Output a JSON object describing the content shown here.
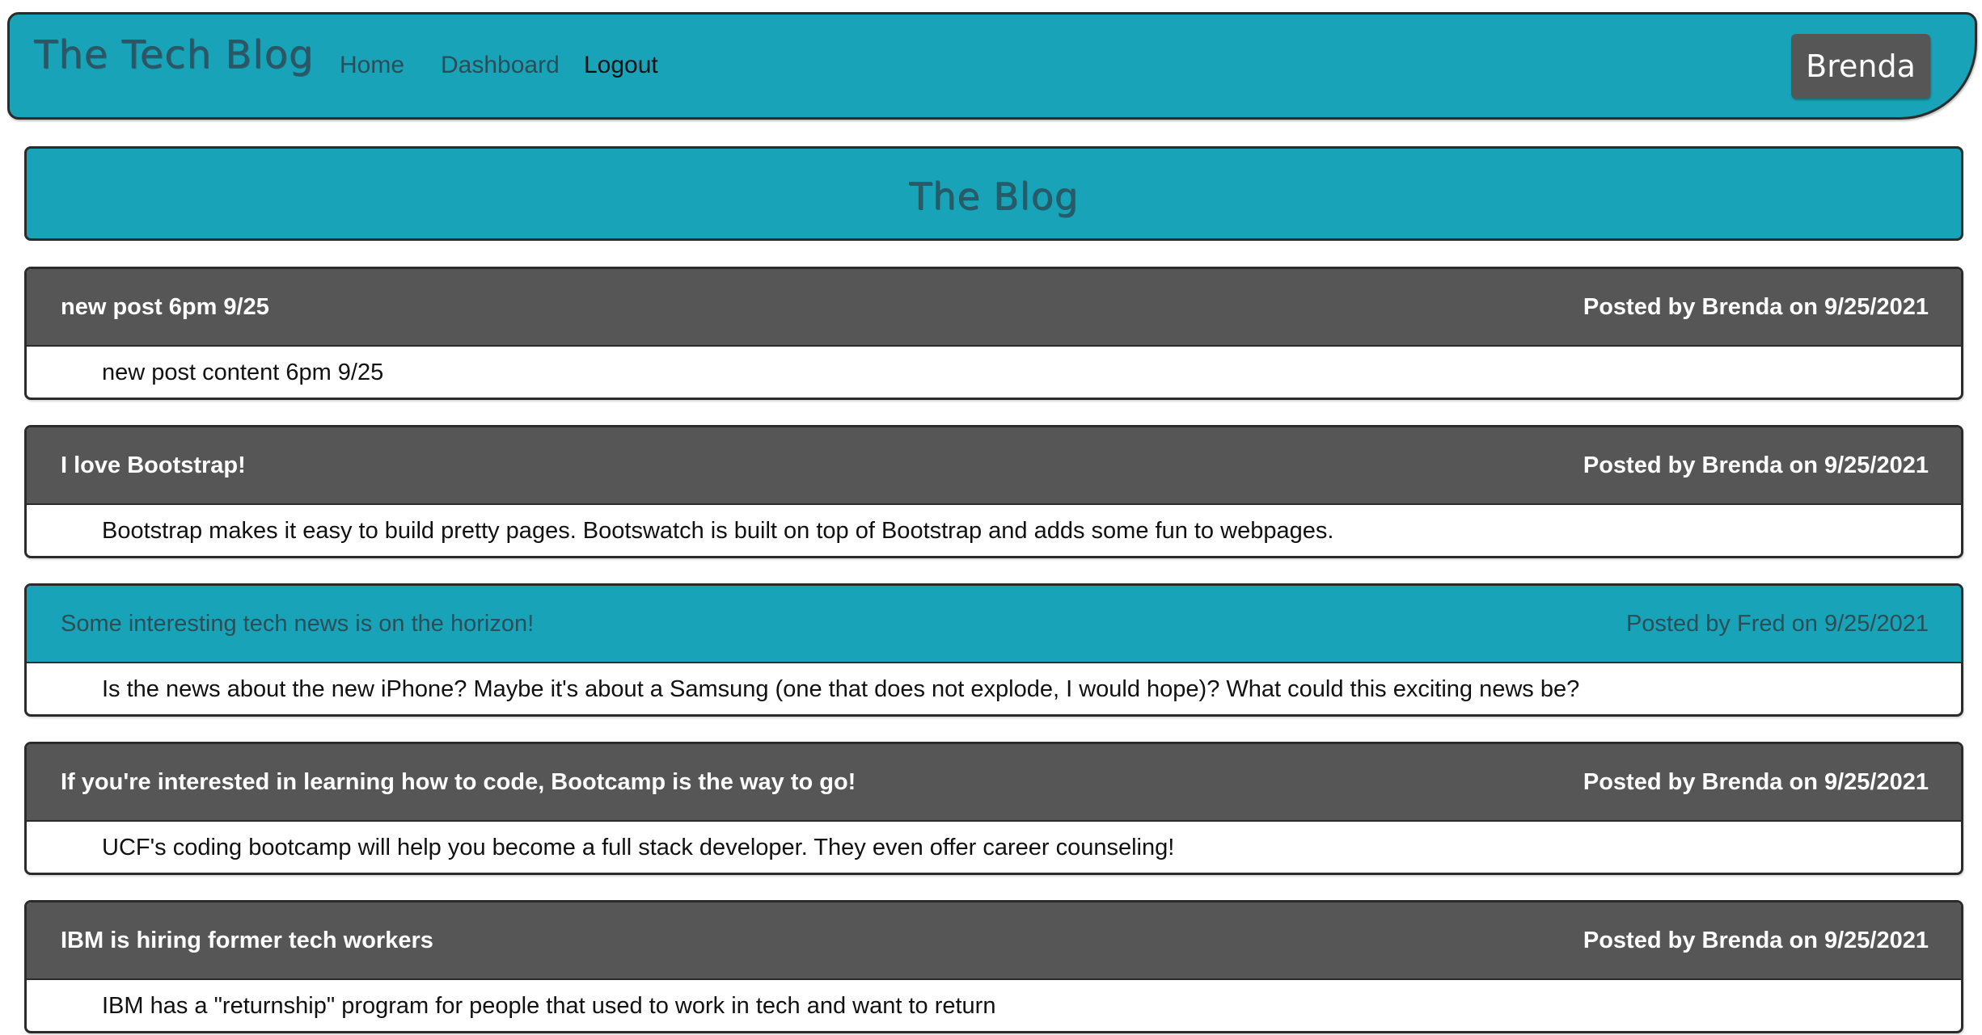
{
  "header": {
    "brand": "The Tech Blog",
    "nav": [
      "Home",
      "Dashboard",
      "Logout"
    ],
    "user": "Brenda"
  },
  "hero": {
    "title": "The Blog"
  },
  "posts": [
    {
      "title": "new post 6pm 9/25",
      "meta": "Posted by Brenda on 9/25/2021",
      "content": "new post content 6pm 9/25"
    },
    {
      "title": "I love Bootstrap!",
      "meta": "Posted by Brenda on 9/25/2021",
      "content": "Bootstrap makes it easy to build pretty pages. Bootswatch is built on top of Bootstrap and adds some fun to webpages."
    },
    {
      "title": "Some interesting tech news is on the horizon!",
      "meta": "Posted by Fred on 9/25/2021",
      "content": "Is the news about the new iPhone? Maybe it's about a Samsung (one that does not explode, I would hope)? What could this exciting news be?"
    },
    {
      "title": "If you're interested in learning how to code, Bootcamp is the way to go!",
      "meta": "Posted by Brenda on 9/25/2021",
      "content": "UCF's coding bootcamp will help you become a full stack developer. They even offer career counseling!"
    },
    {
      "title": "IBM is hiring former tech workers",
      "meta": "Posted by Brenda on 9/25/2021",
      "content": "IBM has a \"returnship\" program for people that used to work in tech and want to return"
    }
  ],
  "colors": {
    "accent": "#19a3b9",
    "post_header": "#565656",
    "border": "#2b2b2b"
  }
}
